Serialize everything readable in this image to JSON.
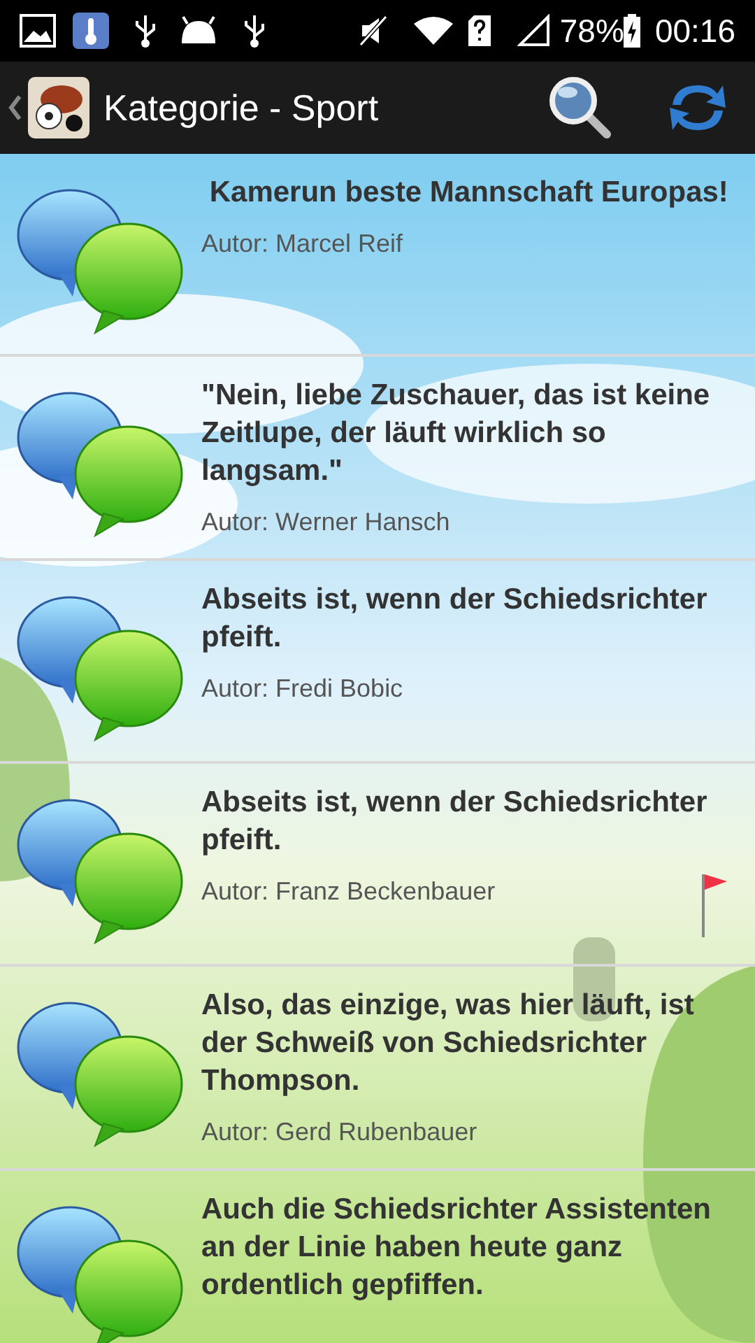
{
  "status_bar": {
    "battery": "78%",
    "time": "00:16"
  },
  "app_bar": {
    "title": "Kategorie - Sport"
  },
  "quotes": [
    {
      "text": " Kamerun beste Mannschaft Europas!",
      "author": "Autor: Marcel Reif"
    },
    {
      "text": "\"Nein, liebe Zuschauer, das ist keine Zeitlupe, der läuft wirklich so langsam.\"",
      "author": "Autor: Werner Hansch"
    },
    {
      "text": "Abseits ist, wenn der Schiedsrichter pfeift.",
      "author": "Autor: Fredi Bobic"
    },
    {
      "text": "Abseits ist, wenn der Schiedsrichter pfeift.",
      "author": "Autor: Franz Beckenbauer"
    },
    {
      "text": "Also, das einzige, was hier läuft, ist der Schweiß von Schiedsrichter Thompson.",
      "author": "Autor: Gerd Rubenbauer"
    },
    {
      "text": "Auch die Schiedsrichter Assistenten an der Linie haben heute ganz ordentlich gepfiffen."
    }
  ]
}
